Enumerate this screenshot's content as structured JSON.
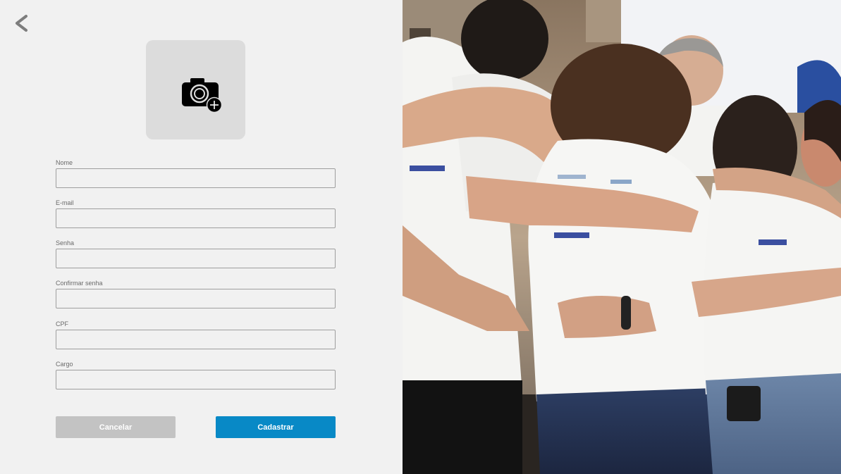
{
  "form": {
    "fields": [
      {
        "label": "Nome",
        "value": "",
        "placeholder": ""
      },
      {
        "label": "E-mail",
        "value": "",
        "placeholder": ""
      },
      {
        "label": "Senha",
        "value": "",
        "placeholder": ""
      },
      {
        "label": "Confirmar senha",
        "value": "",
        "placeholder": ""
      },
      {
        "label": "CPF",
        "value": "",
        "placeholder": ""
      },
      {
        "label": "Cargo",
        "value": "",
        "placeholder": ""
      }
    ],
    "cancel_label": "Cancelar",
    "submit_label": "Cadastrar"
  },
  "icons": {
    "back": "chevron-left-icon",
    "avatar": "camera-add-icon"
  },
  "colors": {
    "primary": "#0889c6",
    "secondary": "#c3c3c3",
    "background": "#f1f1f1"
  }
}
